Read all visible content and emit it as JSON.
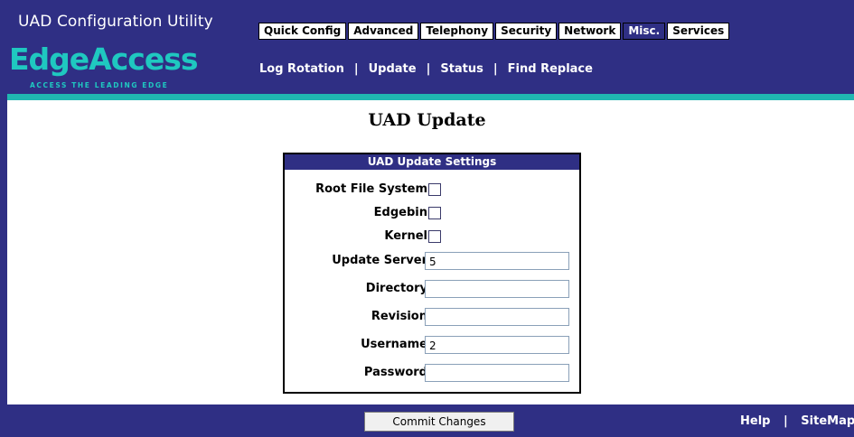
{
  "header": {
    "app_title": "UAD Configuration Utility",
    "tabs": [
      {
        "label": "Quick Config",
        "active": false
      },
      {
        "label": "Advanced",
        "active": false
      },
      {
        "label": "Telephony",
        "active": false
      },
      {
        "label": "Security",
        "active": false
      },
      {
        "label": "Network",
        "active": false
      },
      {
        "label": "Misc.",
        "active": true
      },
      {
        "label": "Services",
        "active": false
      }
    ],
    "logo": {
      "name": "EdgeAccess",
      "tagline": "ACCESS THE LEADING EDGE"
    },
    "subnav": [
      "Log Rotation",
      "Update",
      "Status",
      "Find Replace"
    ],
    "subnav_separator": "|"
  },
  "page": {
    "title": "UAD Update"
  },
  "settings": {
    "header": "UAD Update Settings",
    "checkboxes": [
      {
        "label": "Root File System",
        "checked": false
      },
      {
        "label": "Edgebin",
        "checked": false
      },
      {
        "label": "Kernel",
        "checked": false
      }
    ],
    "fields": [
      {
        "label": "Update Server",
        "value": "5"
      },
      {
        "label": "Directory",
        "value": ""
      },
      {
        "label": "Revision",
        "value": ""
      },
      {
        "label": "Username",
        "value": "2"
      },
      {
        "label": "Password",
        "value": ""
      }
    ]
  },
  "footer": {
    "commit_label": "Commit Changes",
    "links": [
      "Help",
      "SiteMap"
    ],
    "separator": "|"
  },
  "colors": {
    "navy": "#2f2f84",
    "teal": "#20b7b1",
    "logo": "#1fc8c0"
  }
}
